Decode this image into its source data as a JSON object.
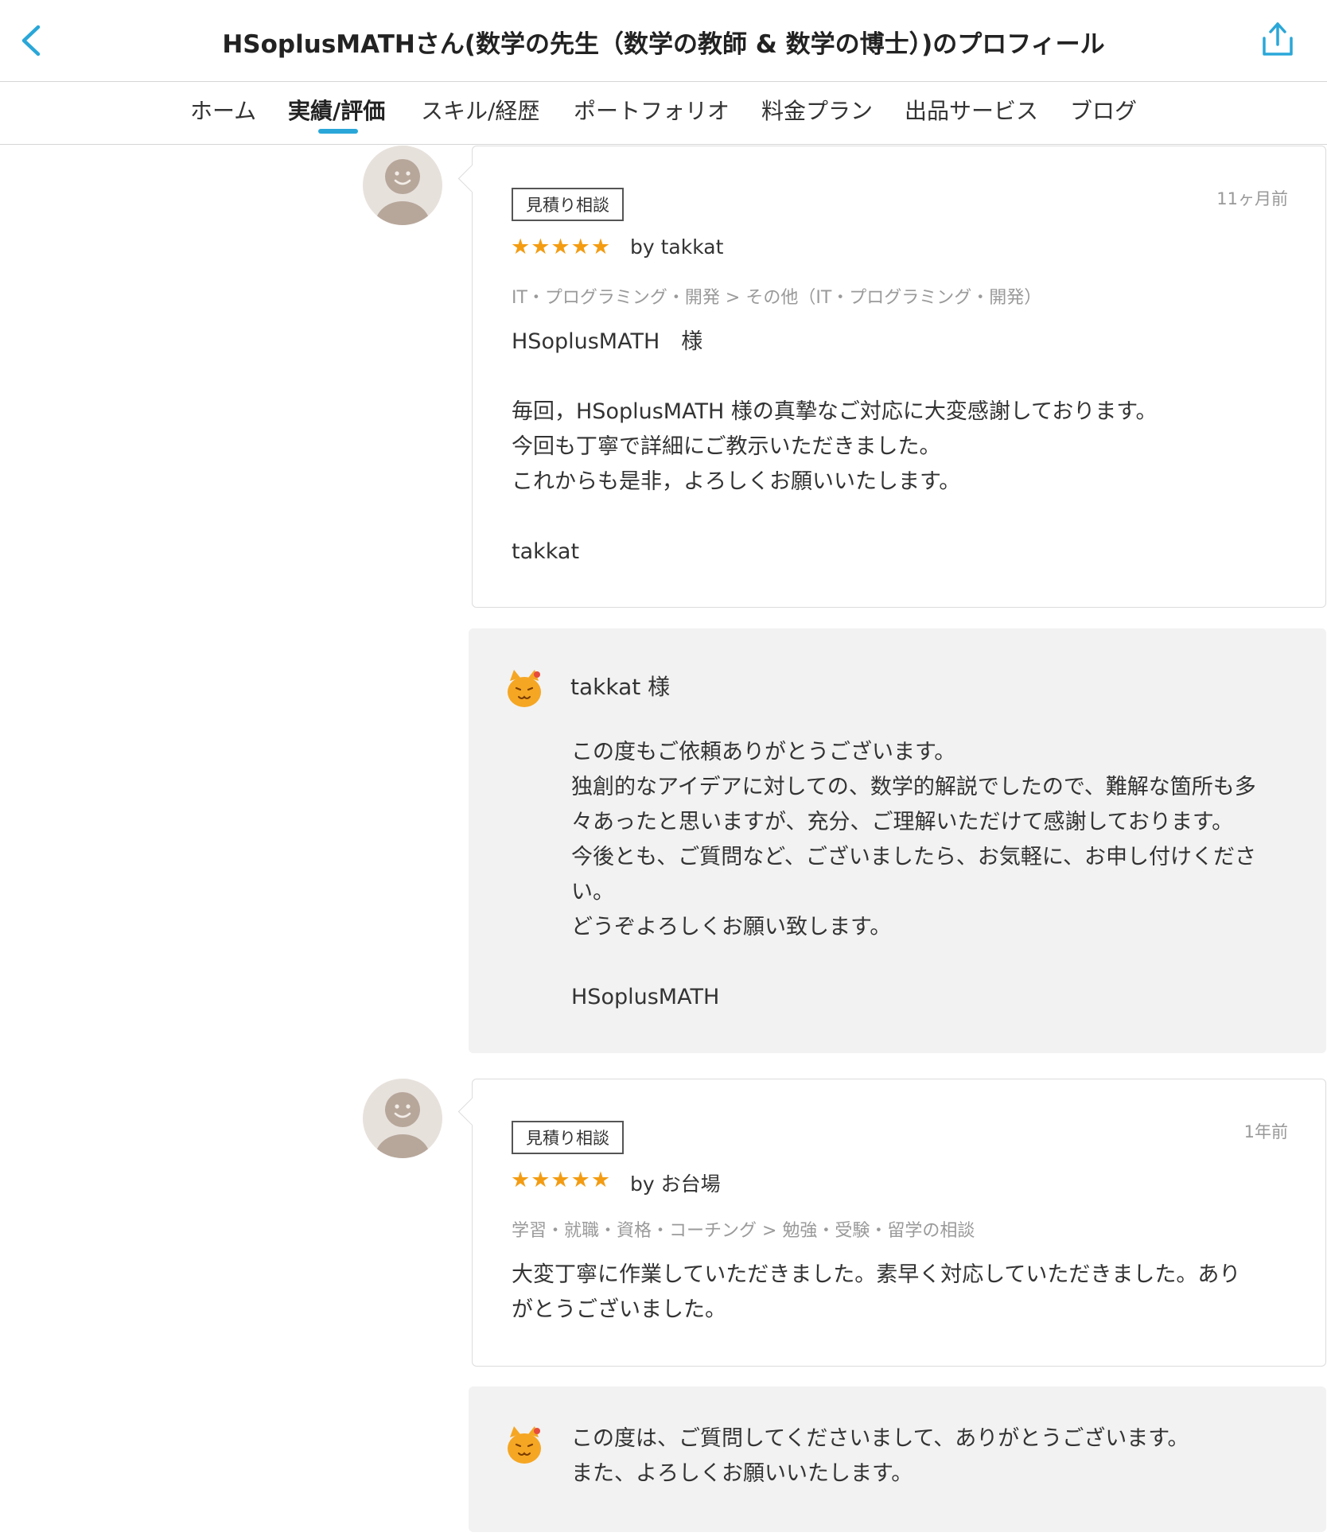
{
  "header": {
    "title": "HSoplusMATHさん(数学の先生（数学の教師 & 数学の博士）)のプロフィール",
    "back_icon": "chevron-left-icon",
    "share_icon": "share-icon",
    "accent_color": "#2aa7d8"
  },
  "tabs": [
    {
      "label": "ホーム",
      "active": false
    },
    {
      "label": "実績/評価",
      "active": true
    },
    {
      "label": "スキル/経歴",
      "active": false
    },
    {
      "label": "ポートフォリオ",
      "active": false
    },
    {
      "label": "料金プラン",
      "active": false
    },
    {
      "label": "出品サービス",
      "active": false
    },
    {
      "label": "ブログ",
      "active": false
    }
  ],
  "reviews": [
    {
      "badge": "見積り相談",
      "time": "11ヶ月前",
      "stars": "★★★★★",
      "rating": 5,
      "reviewer": "by takkat",
      "category": "IT・プログラミング・開発 > その他（IT・プログラミング・開発）",
      "body": "HSoplusMATH　様\n\n毎回，HSoplusMATH 様の真摯なご対応に大変感謝しております。\n今回も丁寧で詳細にご教示いただきました。\nこれからも是非，よろしくお願いいたします。\n\ntakkat",
      "reply": {
        "greeting": "takkat 様",
        "body": "この度もご依頼ありがとうございます。\n独創的なアイデアに対しての、数学的解説でしたので、難解な箇所も多\n々あったと思いますが、充分、ご理解いただけて感謝しております。\n今後とも、ご質問など、ございましたら、お気軽に、お申し付けくださ\nい。\nどうぞよろしくお願い致します。\n\nHSoplusMATH"
      }
    },
    {
      "badge": "見積り相談",
      "time": "1年前",
      "stars": "★★★★★",
      "rating": 5,
      "reviewer": "by お台場",
      "category": "学習・就職・資格・コーチング > 勉強・受験・留学の相談",
      "body": "大変丁寧に作業していただきました。素早く対応していただきました。あり\nがとうございました。",
      "reply": {
        "greeting": "",
        "body": "この度は、ご質問してくださいまして、ありがとうございます。\nまた、よろしくお願いいたします。"
      }
    }
  ],
  "icons": {
    "reviewer_avatar": "default-user-avatar-icon",
    "seller_avatar": "cat-mascot-icon"
  }
}
